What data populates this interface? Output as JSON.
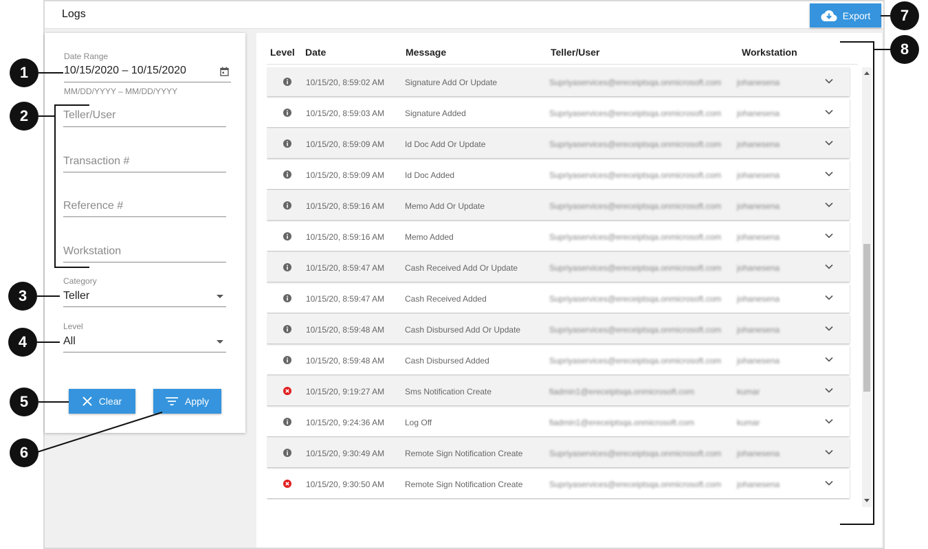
{
  "header": {
    "title": "Logs",
    "export_label": "Export"
  },
  "filters": {
    "date_range": {
      "label": "Date Range",
      "value": "10/15/2020 – 10/15/2020",
      "hint": "MM/DD/YYYY – MM/DD/YYYY"
    },
    "teller_placeholder": "Teller/User",
    "transaction_placeholder": "Transaction #",
    "reference_placeholder": "Reference #",
    "workstation_placeholder": "Workstation",
    "category": {
      "label": "Category",
      "value": "Teller"
    },
    "level": {
      "label": "Level",
      "value": "All"
    },
    "clear_label": "Clear",
    "apply_label": "Apply"
  },
  "table": {
    "columns": [
      "Level",
      "Date",
      "Message",
      "Teller/User",
      "Workstation"
    ],
    "rows": [
      {
        "level": "info",
        "date": "10/15/20, 8:59:02 AM",
        "message": "Signature Add Or Update",
        "user": "Supriyaservices@ereceiptsqa.onmicrosoft.com",
        "workstation": "johanesena"
      },
      {
        "level": "info",
        "date": "10/15/20, 8:59:03 AM",
        "message": "Signature Added",
        "user": "Supriyaservices@ereceiptsqa.onmicrosoft.com",
        "workstation": "johanesena"
      },
      {
        "level": "info",
        "date": "10/15/20, 8:59:09 AM",
        "message": "Id Doc Add Or Update",
        "user": "Supriyaservices@ereceiptsqa.onmicrosoft.com",
        "workstation": "johanesena"
      },
      {
        "level": "info",
        "date": "10/15/20, 8:59:09 AM",
        "message": "Id Doc Added",
        "user": "Supriyaservices@ereceiptsqa.onmicrosoft.com",
        "workstation": "johanesena"
      },
      {
        "level": "info",
        "date": "10/15/20, 8:59:16 AM",
        "message": "Memo Add Or Update",
        "user": "Supriyaservices@ereceiptsqa.onmicrosoft.com",
        "workstation": "johanesena"
      },
      {
        "level": "info",
        "date": "10/15/20, 8:59:16 AM",
        "message": "Memo Added",
        "user": "Supriyaservices@ereceiptsqa.onmicrosoft.com",
        "workstation": "johanesena"
      },
      {
        "level": "info",
        "date": "10/15/20, 8:59:47 AM",
        "message": "Cash Received Add Or Update",
        "user": "Supriyaservices@ereceiptsqa.onmicrosoft.com",
        "workstation": "johanesena"
      },
      {
        "level": "info",
        "date": "10/15/20, 8:59:47 AM",
        "message": "Cash Received Added",
        "user": "Supriyaservices@ereceiptsqa.onmicrosoft.com",
        "workstation": "johanesena"
      },
      {
        "level": "info",
        "date": "10/15/20, 8:59:48 AM",
        "message": "Cash Disbursed Add Or Update",
        "user": "Supriyaservices@ereceiptsqa.onmicrosoft.com",
        "workstation": "johanesena"
      },
      {
        "level": "info",
        "date": "10/15/20, 8:59:48 AM",
        "message": "Cash Disbursed Added",
        "user": "Supriyaservices@ereceiptsqa.onmicrosoft.com",
        "workstation": "johanesena"
      },
      {
        "level": "error",
        "date": "10/15/20, 9:19:27 AM",
        "message": "Sms Notification Create",
        "user": "fiadmin1@ereceiptsqa.onmicrosoft.com",
        "workstation": "kumar"
      },
      {
        "level": "info",
        "date": "10/15/20, 9:24:36 AM",
        "message": "Log Off",
        "user": "fiadmin1@ereceiptsqa.onmicrosoft.com",
        "workstation": "kumar"
      },
      {
        "level": "info",
        "date": "10/15/20, 9:30:49 AM",
        "message": "Remote Sign Notification Create",
        "user": "Supriyaservices@ereceiptsqa.onmicrosoft.com",
        "workstation": "johanesena"
      },
      {
        "level": "error",
        "date": "10/15/20, 9:30:50 AM",
        "message": "Remote Sign Notification Create",
        "user": "Supriyaservices@ereceiptsqa.onmicrosoft.com",
        "workstation": "johanesena"
      }
    ]
  },
  "callouts": [
    "1",
    "2",
    "3",
    "4",
    "5",
    "6",
    "7",
    "8"
  ],
  "colors": {
    "accent": "#3594dd",
    "error": "#e02020",
    "info": "#666666",
    "callout": "#111111"
  }
}
